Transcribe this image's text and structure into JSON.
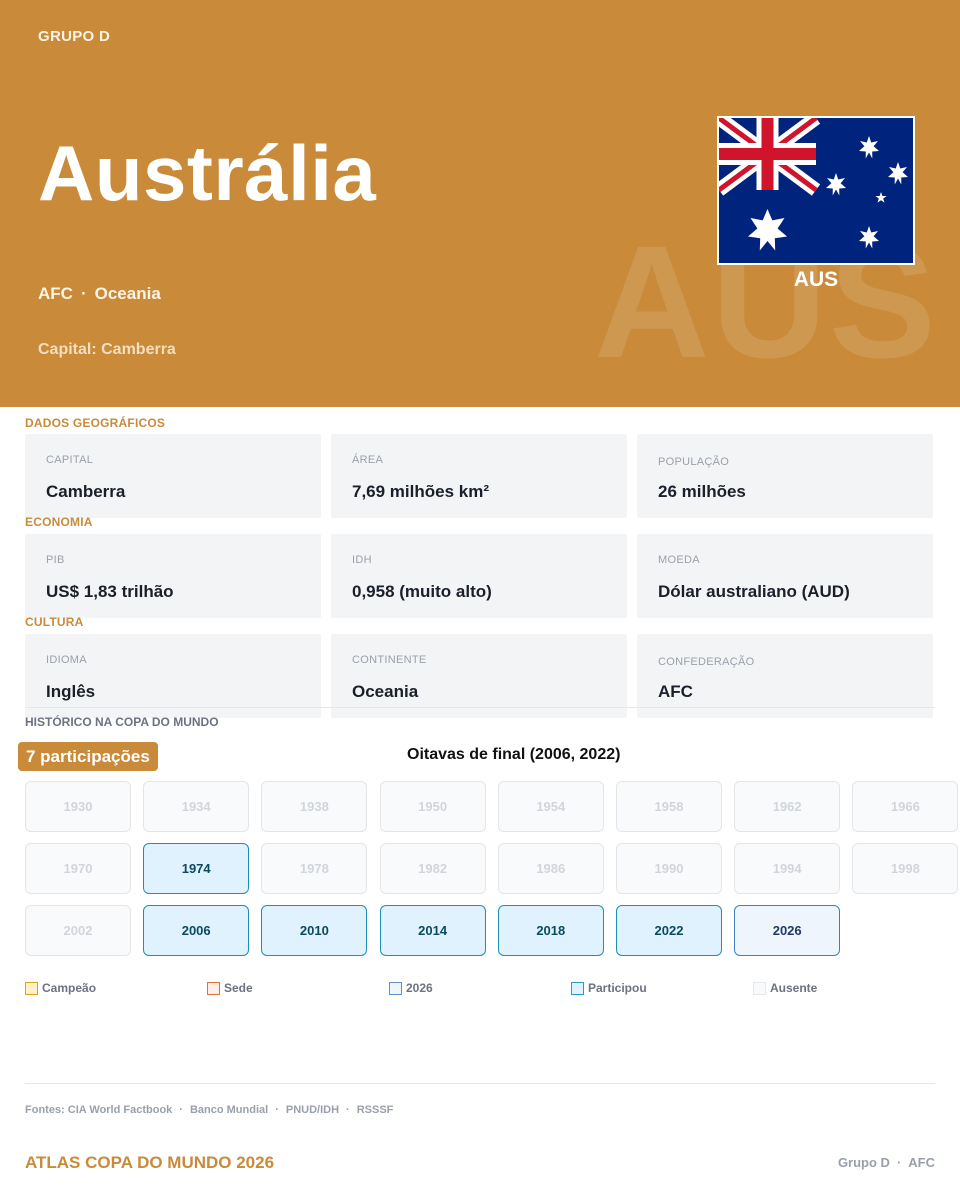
{
  "header": {
    "group": "GRUPO D",
    "country": "Austrália",
    "confederation": "AFC",
    "dot": "·",
    "region": "Oceania",
    "capital_line": "Capital: Camberra",
    "watermark": "AUS",
    "code": "AUS",
    "flag_icon": "australia-flag-icon",
    "accent_color": "#c98a3a"
  },
  "geo": {
    "title": "DADOS GEOGRÁFICOS",
    "cards": [
      {
        "label": "CAPITAL",
        "value": "Camberra"
      },
      {
        "label": "ÁREA",
        "value": "7,69 milhões km²"
      },
      {
        "label": "POPULAÇÃO",
        "value": "26 milhões"
      }
    ]
  },
  "economy": {
    "title": "ECONOMIA",
    "cards": [
      {
        "label": "PIB",
        "value": "US$ 1,83 trilhão"
      },
      {
        "label": "IDH",
        "value": "0,958 (muito alto)"
      },
      {
        "label": "MOEDA",
        "value": "Dólar australiano (AUD)"
      }
    ]
  },
  "culture": {
    "title": "CULTURA",
    "cards": [
      {
        "label": "IDIOMA",
        "value": "Inglês"
      },
      {
        "label": "CONTINENTE",
        "value": "Oceania"
      },
      {
        "label": "CONFEDERAÇÃO",
        "value": "AFC"
      }
    ]
  },
  "history": {
    "title": "HISTÓRICO NA COPA DO MUNDO",
    "badge": "7 participações",
    "best": "Oitavas de final (2006, 2022)",
    "years": [
      {
        "year": "1930",
        "status": "absent"
      },
      {
        "year": "1934",
        "status": "absent"
      },
      {
        "year": "1938",
        "status": "absent"
      },
      {
        "year": "1950",
        "status": "absent"
      },
      {
        "year": "1954",
        "status": "absent"
      },
      {
        "year": "1958",
        "status": "absent"
      },
      {
        "year": "1962",
        "status": "absent"
      },
      {
        "year": "1966",
        "status": "absent"
      },
      {
        "year": "1970",
        "status": "absent"
      },
      {
        "year": "1974",
        "status": "participated"
      },
      {
        "year": "1978",
        "status": "absent"
      },
      {
        "year": "1982",
        "status": "absent"
      },
      {
        "year": "1986",
        "status": "absent"
      },
      {
        "year": "1990",
        "status": "absent"
      },
      {
        "year": "1994",
        "status": "absent"
      },
      {
        "year": "1998",
        "status": "absent"
      },
      {
        "year": "2002",
        "status": "absent"
      },
      {
        "year": "2006",
        "status": "participated"
      },
      {
        "year": "2010",
        "status": "participated"
      },
      {
        "year": "2014",
        "status": "participated"
      },
      {
        "year": "2018",
        "status": "participated"
      },
      {
        "year": "2022",
        "status": "participated"
      },
      {
        "year": "2026",
        "status": "2026"
      }
    ],
    "legend": [
      {
        "label": "Campeão",
        "border": "#e0a020",
        "fill": "#fdf3c9"
      },
      {
        "label": "Sede",
        "border": "#e0703a",
        "fill": "#fdeee6"
      },
      {
        "label": "2026",
        "border": "#5f8fd0",
        "fill": "#eef5fd"
      },
      {
        "label": "Participou",
        "border": "#2a9bc4",
        "fill": "#e0f2fd"
      },
      {
        "label": "Ausente",
        "border": "#e5e7eb",
        "fill": "#f9fafb"
      }
    ]
  },
  "footer": {
    "sources": [
      "Fontes: CIA World Factbook",
      "Banco Mundial",
      "PNUD/IDH",
      "RSSSF"
    ],
    "sep": "·",
    "brand": "ATLAS COPA DO MUNDO 2026",
    "right_group": "Grupo D",
    "right_conf": "AFC"
  }
}
